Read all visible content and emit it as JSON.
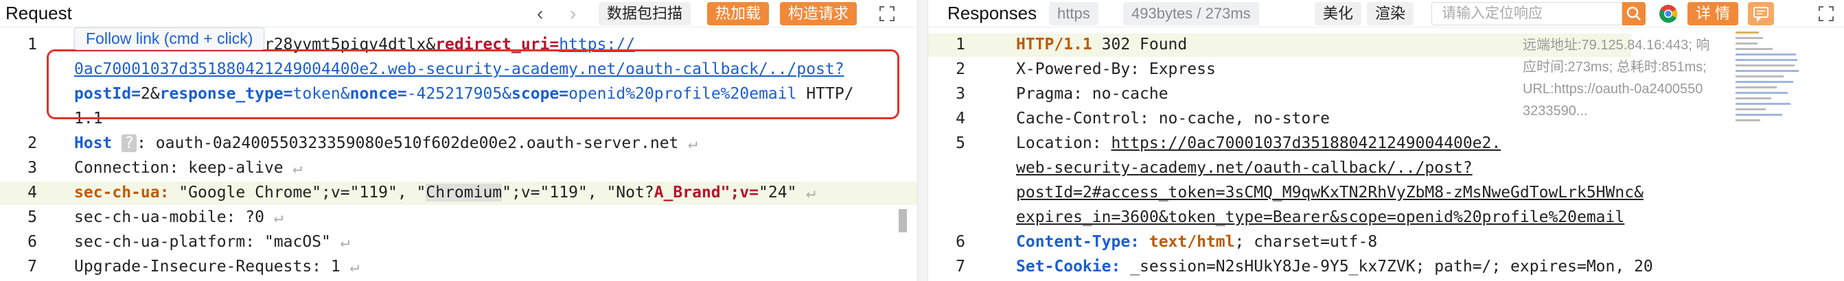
{
  "request": {
    "title": "Request",
    "toolbar": {
      "back": "‹",
      "forward": "›",
      "scan_btn": "数据包扫描",
      "hot_btn": "热加载",
      "build_btn": "构造请求"
    },
    "tooltip": "Follow link (cmd + click)",
    "lines": {
      "l1_num": "1",
      "l1_prefix": "xnr28yvmt5piqv4dtlx&",
      "l1_key": "redirect_uri=",
      "l1_url_a": "https://",
      "l1_url_b": "0ac70001037d351880421249004400e2.web-security-academy.net/oauth-callback/../post?",
      "l1_p_postId": "postId=",
      "l1_v_postId": "2&",
      "l1_p_rt": "response_type=",
      "l1_v_rt": "token&",
      "l1_p_nonce": "nonce=",
      "l1_v_nonce": "-425217905&",
      "l1_p_scope": "scope=",
      "l1_v_scope": "openid%20profile%20email",
      "l1_proto_a": " HTTP/",
      "l1_proto_b": "1.1",
      "l2_num": "2",
      "l2_key": "Host",
      "l2_q": "?",
      "l2_val": ": oauth-0a2400550323359080e510f602de00e2.oauth-server.net",
      "l3_num": "3",
      "l3_text": "Connection: keep-alive",
      "l4_num": "4",
      "l4_key": "sec-ch-ua:",
      "l4_a": " \"Google Chrome\";v=\"119\", \"",
      "l4_sel": "Chromium",
      "l4_b": "\";v=\"119\", \"Not?",
      "l4_c": "A_Brand\";v=",
      "l4_d": "\"24\"",
      "l5_num": "5",
      "l5_text": "sec-ch-ua-mobile: ?0",
      "l6_num": "6",
      "l6_text": "sec-ch-ua-platform: \"macOS\"",
      "l7_num": "7",
      "l7_text": "Upgrade-Insecure-Requests: 1"
    }
  },
  "response": {
    "title": "Responses",
    "proto_chip": "https",
    "size_chip": "493bytes / 273ms",
    "beautify_btn": "美化",
    "render_btn": "渲染",
    "search_placeholder": "请输入定位响应",
    "detail_btn": "详 情",
    "info": {
      "line1": "远端地址:79.125.84.16:443; 响",
      "line2": "应时间:273ms; 总耗时:851ms;",
      "line3": "URL:https://oauth-0a2400550",
      "line4": "3233590..."
    },
    "lines": {
      "l1_num": "1",
      "l1_proto": "HTTP/1.1",
      "l1_status": " 302 Found",
      "l2_num": "2",
      "l2_text": "X-Powered-By: Express",
      "l3_num": "3",
      "l3_text": "Pragma: no-cache",
      "l4_num": "4",
      "l4_text": "Cache-Control: no-cache, no-store",
      "l5_num": "5",
      "l5_key": "Location: ",
      "l5_a": "https://0ac70001037d351880421249004400e2.",
      "l5_b": "web-security-academy.net/oauth-callback/../post?",
      "l5_c": "postId=2#access_token=3sCMQ_M9qwKxTN2RhVyZbM8-zMsNweGdTowLrk5HWnc&",
      "l5_d": "expires_in=3600&token_type=Bearer&scope=openid%20profile%20email",
      "l6_num": "6",
      "l6_key": "Content-Type:",
      "l6_val": " text/html",
      "l6_rest": "; charset=utf-8",
      "l7_num": "7",
      "l7_key": "Set-Cookie:",
      "l7_rest": " _session=N2sHUkY8Je-9Y5_kx7ZVK; path=/; expires=Mon, 20"
    }
  },
  "colors": {
    "accent": "#f08a3a",
    "highlight_box": "#e0322a",
    "key_blue": "#1c5fd1"
  }
}
